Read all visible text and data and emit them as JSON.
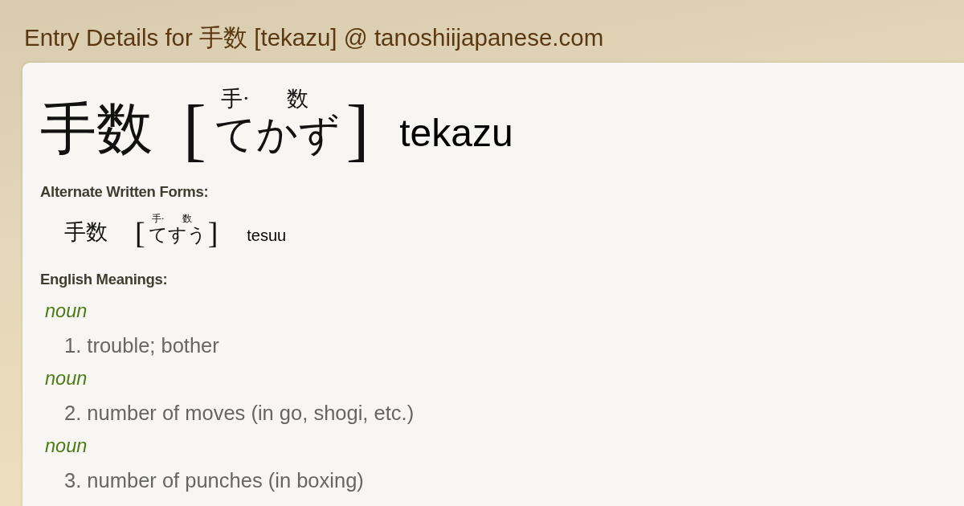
{
  "page_title": "Entry Details for 手数 [tekazu] @ tanoshiijapanese.com",
  "entry": {
    "word": "手数",
    "open_bracket": "[",
    "reading": [
      {
        "ruby": "手·",
        "kana": "て"
      },
      {
        "ruby": "数",
        "kana": "かず"
      }
    ],
    "close_bracket": "]",
    "romaji": "tekazu"
  },
  "alternate_forms": {
    "heading": "Alternate Written Forms:",
    "forms": [
      {
        "word": "手数",
        "open_bracket": "[",
        "reading": [
          {
            "ruby": "手·",
            "kana": "て"
          },
          {
            "ruby": "数",
            "kana": "すう"
          }
        ],
        "close_bracket": "]",
        "romaji": "tesuu"
      }
    ]
  },
  "meanings": {
    "heading": "English Meanings:",
    "senses": [
      {
        "part_of_speech": "noun",
        "text": "1. trouble; bother"
      },
      {
        "part_of_speech": "noun",
        "text": "2. number of moves (in go, shogi, etc.)"
      },
      {
        "part_of_speech": "noun",
        "text": "3. number of punches (in boxing)"
      }
    ]
  }
}
